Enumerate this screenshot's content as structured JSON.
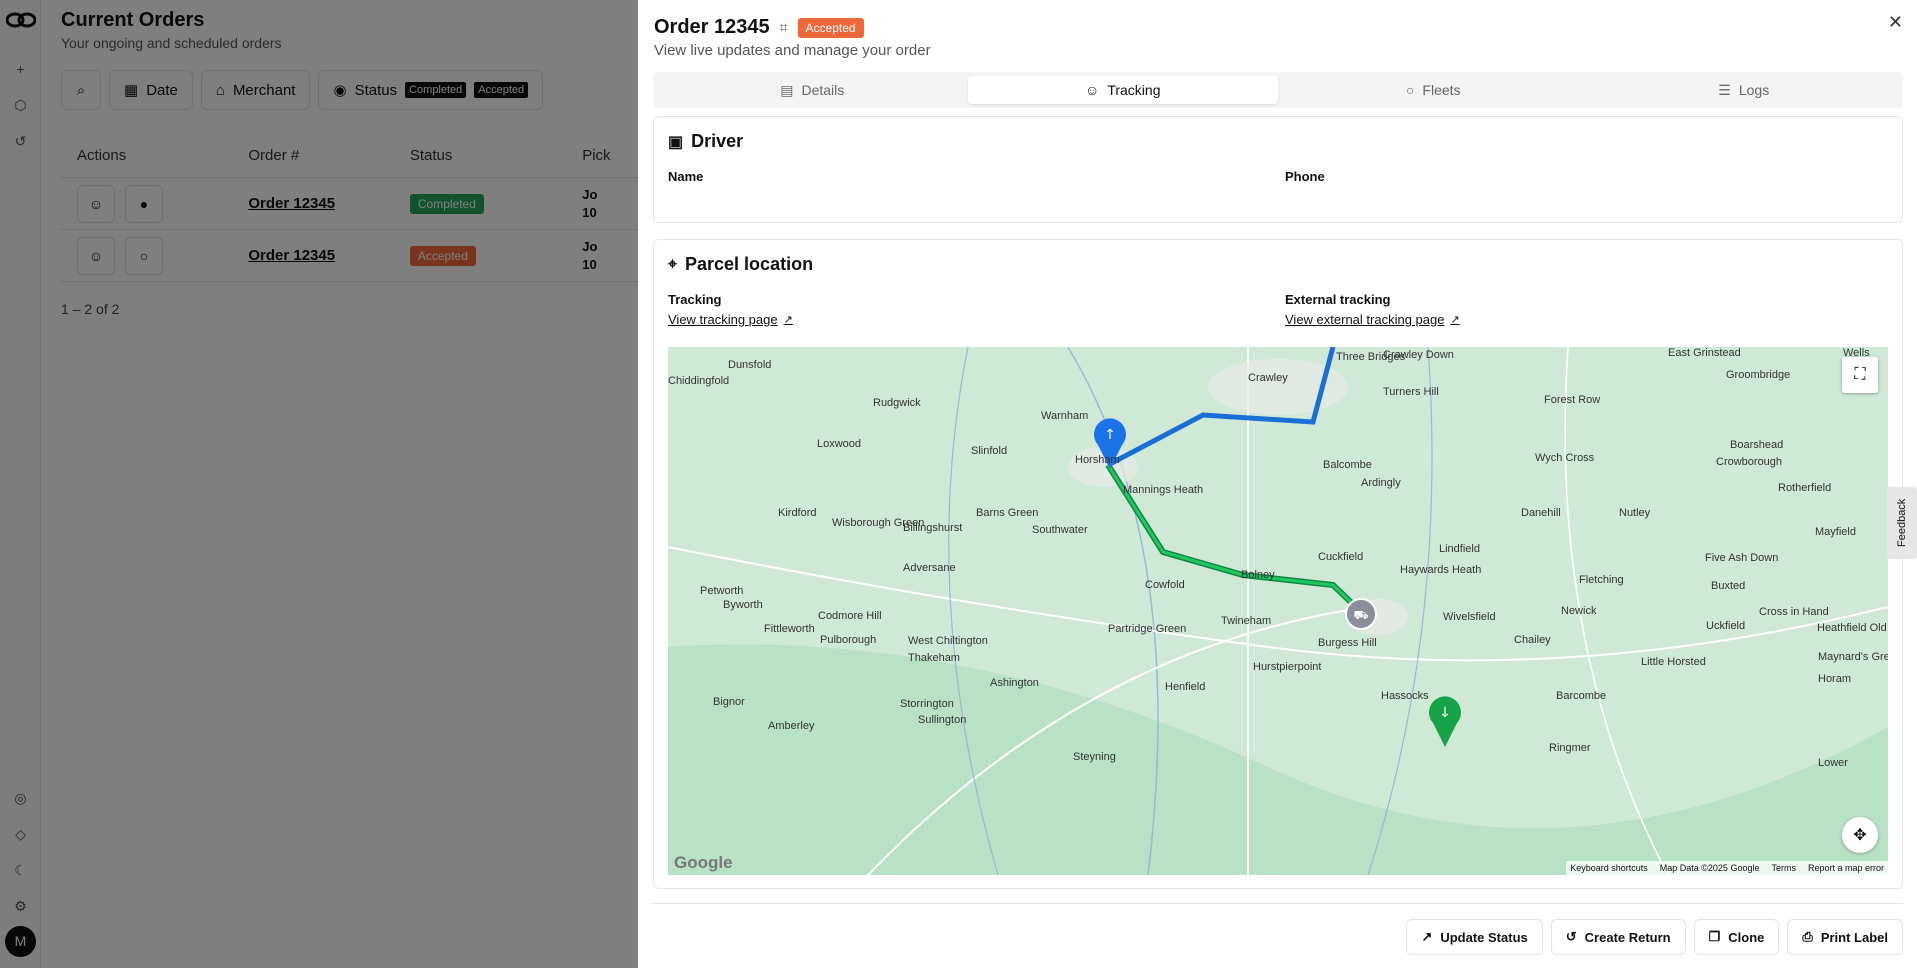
{
  "page": {
    "title": "Current Orders",
    "subtitle": "Your ongoing and scheduled orders",
    "filters": [
      "Date",
      "Merchant",
      "Status"
    ],
    "status_chips": [
      "Completed",
      "Accepted"
    ],
    "columns": [
      "Actions",
      "Order #",
      "Status",
      "Pick"
    ],
    "rows": [
      {
        "order": "Order 12345",
        "status": "Completed",
        "status_color": "#22a35a",
        "pick_line1": "Jo",
        "pick_line2": "10"
      },
      {
        "order": "Order 12345",
        "status": "Accepted",
        "status_color": "#f0683a",
        "pick_line1": "Jo",
        "pick_line2": "10"
      }
    ],
    "pager": "1 – 2 of 2",
    "avatar": "M"
  },
  "panel": {
    "title": "Order 12345",
    "badge": "Accepted",
    "badge_color": "#f0683a",
    "subtitle": "View live updates and manage your order",
    "tabs": [
      {
        "label": "Details",
        "icon": "document-icon"
      },
      {
        "label": "Tracking",
        "icon": "person-icon"
      },
      {
        "label": "Fleets",
        "icon": "chat-icon"
      },
      {
        "label": "Logs",
        "icon": "list-icon"
      }
    ],
    "driver": {
      "heading": "Driver",
      "name_label": "Name",
      "phone_label": "Phone"
    },
    "parcel": {
      "heading": "Parcel location",
      "tracking_label": "Tracking",
      "tracking_link": "View tracking page",
      "external_label": "External tracking",
      "external_link": "View external tracking page"
    },
    "map": {
      "attribution": [
        "Keyboard shortcuts",
        "Map Data ©2025 Google",
        "Terms",
        "Report a map error"
      ],
      "google": "Google",
      "places": [
        {
          "n": "Dunsfold"
        },
        {
          "n": "Chiddingfold"
        },
        {
          "n": "Rudgwick"
        },
        {
          "n": "Warnham"
        },
        {
          "n": "Crawley"
        },
        {
          "n": "Crawley Down"
        },
        {
          "n": "Turners Hill"
        },
        {
          "n": "Forest Row"
        },
        {
          "n": "Groombridge"
        },
        {
          "n": "Loxwood"
        },
        {
          "n": "Slinfold"
        },
        {
          "n": "Horsham"
        },
        {
          "n": "Balcombe"
        },
        {
          "n": "Wych Cross"
        },
        {
          "n": "Boarshead"
        },
        {
          "n": "Crowborough"
        },
        {
          "n": "Ardingly"
        },
        {
          "n": "Rotherfield"
        },
        {
          "n": "Kirdford"
        },
        {
          "n": "Barns Green"
        },
        {
          "n": "Mannings Heath"
        },
        {
          "n": "Danehill"
        },
        {
          "n": "Nutley"
        },
        {
          "n": "Wisborough Green"
        },
        {
          "n": "Billingshurst"
        },
        {
          "n": "Southwater"
        },
        {
          "n": "Lindfield"
        },
        {
          "n": "Mayfield"
        },
        {
          "n": "Five Ash Down"
        },
        {
          "n": "Haywards Heath"
        },
        {
          "n": "Cuckfield"
        },
        {
          "n": "Adversane"
        },
        {
          "n": "Bolney"
        },
        {
          "n": "Cowfold"
        },
        {
          "n": "Fletching"
        },
        {
          "n": "Buxted"
        },
        {
          "n": "Petworth"
        },
        {
          "n": "Byworth"
        },
        {
          "n": "Codmore Hill"
        },
        {
          "n": "Wivelsfield"
        },
        {
          "n": "Newick"
        },
        {
          "n": "Cross in Hand"
        },
        {
          "n": "Twineham"
        },
        {
          "n": "Uckfield"
        },
        {
          "n": "Heathfield Old Heat"
        },
        {
          "n": "Fittleworth"
        },
        {
          "n": "Pulborough"
        },
        {
          "n": "West Chiltington"
        },
        {
          "n": "Partridge Green"
        },
        {
          "n": "Burgess Hill"
        },
        {
          "n": "Chailey"
        },
        {
          "n": "Thakeham"
        },
        {
          "n": "Hurstpierpoint"
        },
        {
          "n": "Little Horsted"
        },
        {
          "n": "Maynard's Green"
        },
        {
          "n": "Ashington"
        },
        {
          "n": "Henfield"
        },
        {
          "n": "Hassocks"
        },
        {
          "n": "Barcombe"
        },
        {
          "n": "Horam"
        },
        {
          "n": "Bignor"
        },
        {
          "n": "Storrington"
        },
        {
          "n": "Sullington"
        },
        {
          "n": "Amberley"
        },
        {
          "n": "Ringmer"
        },
        {
          "n": "Steyning"
        },
        {
          "n": "Lower"
        },
        {
          "n": "Three Bridges"
        },
        {
          "n": "Wells"
        },
        {
          "n": "East Grinstead"
        }
      ]
    },
    "actions": [
      "Update Status",
      "Create Return",
      "Clone",
      "Print Label"
    ],
    "feedback": "Feedback"
  }
}
